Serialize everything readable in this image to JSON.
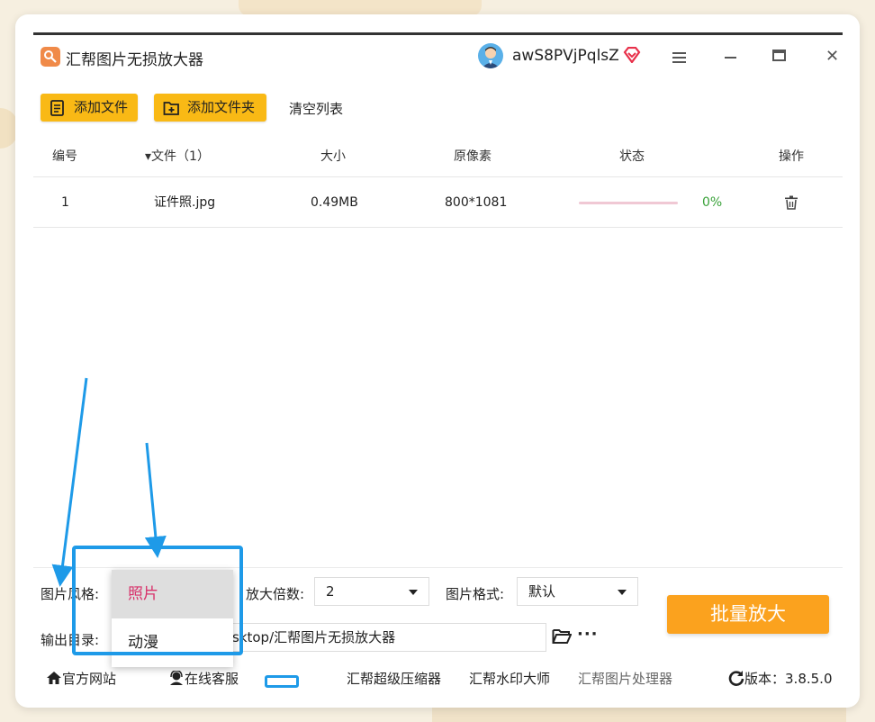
{
  "app": {
    "title": "汇帮图片无损放大器",
    "username": "awS8PVjPqlsZ"
  },
  "toolbar": {
    "add_file": "添加文件",
    "add_folder": "添加文件夹",
    "clear_list": "清空列表"
  },
  "table": {
    "headers": {
      "index": "编号",
      "file": "文件（1）",
      "size": "大小",
      "pixels": "原像素",
      "status": "状态",
      "action": "操作"
    },
    "rows": [
      {
        "index": "1",
        "file": "证件照.jpg",
        "size": "0.49MB",
        "pixels": "800*1081",
        "progress": 0,
        "percent": "0%"
      }
    ]
  },
  "settings": {
    "style_label": "图片风格:",
    "scale_label": "放大倍数:",
    "scale_value": "2",
    "format_label": "图片格式:",
    "format_value": "默认",
    "output_label": "输出目录:",
    "output_path": "sktop/汇帮图片无损放大器",
    "batch_button": "批量放大"
  },
  "style_dropdown": {
    "options": [
      "照片",
      "动漫"
    ],
    "selected": "照片"
  },
  "footer": {
    "website": "官方网站",
    "service": "在线客服",
    "compressor": "汇帮超级压缩器",
    "watermark": "汇帮水印大师",
    "processor": "汇帮图片处理器",
    "version_label": "版本：",
    "version": "3.8.5.0"
  },
  "colors": {
    "accent_yellow": "#f9b915",
    "batch_orange": "#fba21e",
    "selected_pink": "#d8306a",
    "annotation_blue": "#1e9ae8",
    "progress_green": "#3aa23a"
  }
}
